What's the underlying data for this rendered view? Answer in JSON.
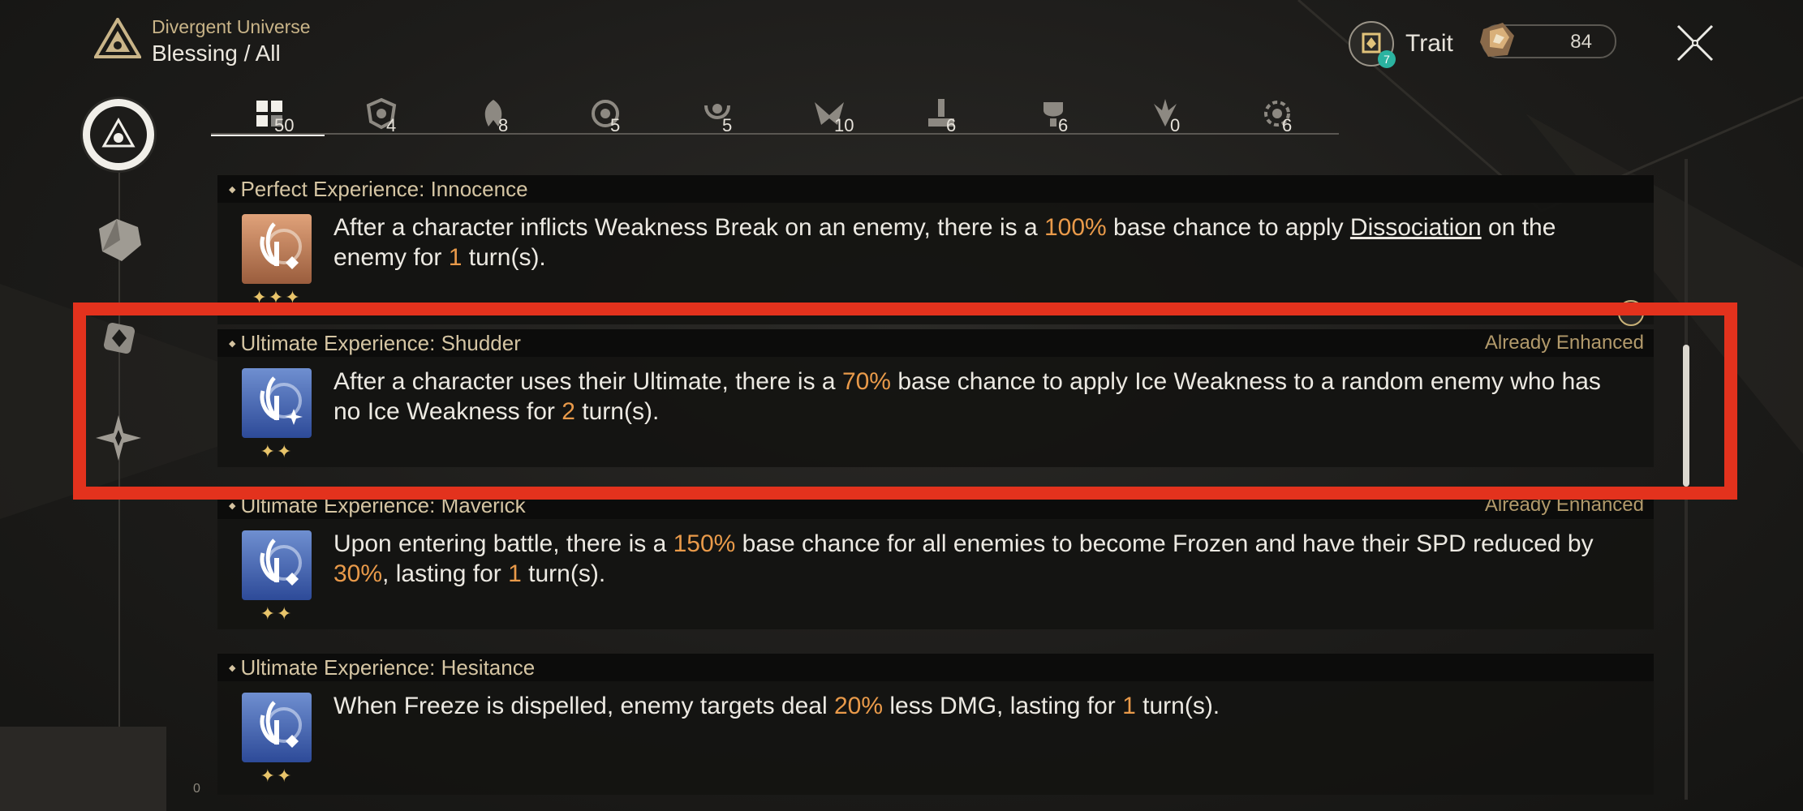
{
  "header": {
    "subtitle": "Divergent Universe",
    "title": "Blessing / All"
  },
  "trait": {
    "label": "Trait",
    "badge": "7"
  },
  "currency": {
    "value": "84"
  },
  "tabs": [
    {
      "count": "50",
      "icon": "grid-all-icon",
      "active": true
    },
    {
      "count": "4",
      "icon": "preservation-icon"
    },
    {
      "count": "8",
      "icon": "remembrance-icon"
    },
    {
      "count": "5",
      "icon": "nihility-icon"
    },
    {
      "count": "5",
      "icon": "abundance-icon"
    },
    {
      "count": "10",
      "icon": "the-hunt-icon"
    },
    {
      "count": "6",
      "icon": "destruction-icon"
    },
    {
      "count": "6",
      "icon": "elation-icon"
    },
    {
      "count": "0",
      "icon": "propagation-icon"
    },
    {
      "count": "6",
      "icon": "erudition-icon"
    }
  ],
  "blessings": [
    {
      "name": "Perfect Experience: Innocence",
      "status": "",
      "stars": "✦✦✦",
      "desc": [
        {
          "t": "After a character inflicts Weakness Break on an enemy, there is a "
        },
        {
          "t": "100%",
          "h": true
        },
        {
          "t": " base chance to apply "
        },
        {
          "t": "Dissociation",
          "u": true
        },
        {
          "t": " on the enemy for "
        },
        {
          "t": "1",
          "h": true
        },
        {
          "t": " turn(s)."
        }
      ]
    },
    {
      "name": "Ultimate Experience: Shudder",
      "status": "Already Enhanced",
      "stars": "✦✦",
      "desc": [
        {
          "t": "After a character uses their Ultimate, there is a "
        },
        {
          "t": "70%",
          "h": true
        },
        {
          "t": " base chance to apply Ice Weakness to a random enemy who has no Ice Weakness for "
        },
        {
          "t": "2",
          "h": true
        },
        {
          "t": " turn(s)."
        }
      ]
    },
    {
      "name": "Ultimate Experience: Maverick",
      "status": "Already Enhanced",
      "stars": "✦✦",
      "desc": [
        {
          "t": "Upon entering battle, there is a "
        },
        {
          "t": "150%",
          "h": true
        },
        {
          "t": " base chance for all enemies to become Frozen and have their SPD reduced by "
        },
        {
          "t": "30%",
          "h": true
        },
        {
          "t": ", lasting for "
        },
        {
          "t": "1",
          "h": true
        },
        {
          "t": " turn(s)."
        }
      ]
    },
    {
      "name": "Ultimate Experience: Hesitance",
      "status": "",
      "stars": "✦✦",
      "desc": [
        {
          "t": "When Freeze is dispelled, enemy targets deal "
        },
        {
          "t": "20%",
          "h": true
        },
        {
          "t": " less DMG, lasting for "
        },
        {
          "t": "1",
          "h": true
        },
        {
          "t": " turn(s)."
        }
      ]
    }
  ],
  "side_caption": "0",
  "colors": {
    "accent": "#e99a4a",
    "gold": "#d5c5a3",
    "highlight_box": "#e3321d"
  }
}
